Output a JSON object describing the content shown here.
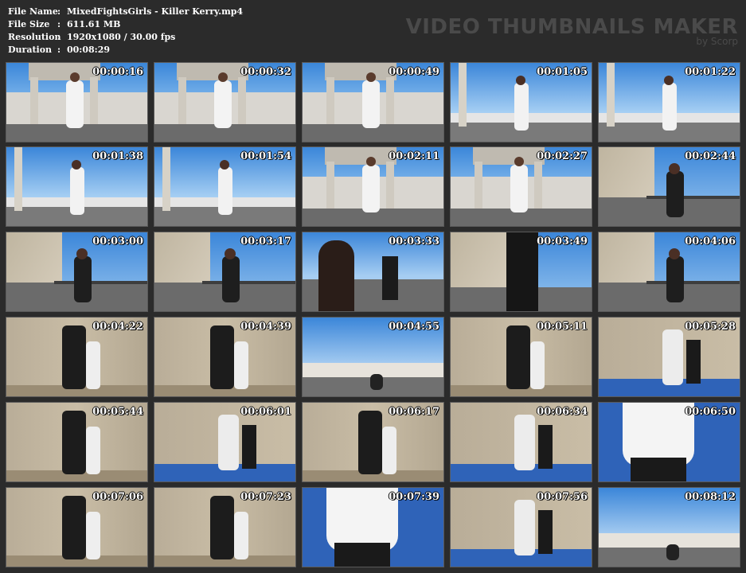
{
  "info": {
    "file_name_label": "File Name",
    "file_name_value": "MixedFightsGirls - Killer Kerry.mp4",
    "file_size_label": "File Size",
    "file_size_value": "611.61 MB",
    "resolution_label": "Resolution",
    "resolution_value": "1920x1080 / 30.00 fps",
    "duration_label": "Duration",
    "duration_value": "00:08:29"
  },
  "brand": {
    "title": "VIDEO THUMBNAILS MAKER",
    "subtitle": "by Scorp"
  },
  "thumbnails": [
    {
      "time": "00:00:16",
      "scene": "sky-building"
    },
    {
      "time": "00:00:32",
      "scene": "sky-building"
    },
    {
      "time": "00:00:49",
      "scene": "sky-building"
    },
    {
      "time": "00:01:05",
      "scene": "sky-harbor"
    },
    {
      "time": "00:01:22",
      "scene": "sky-harbor"
    },
    {
      "time": "00:01:38",
      "scene": "sky-harbor"
    },
    {
      "time": "00:01:54",
      "scene": "sky-harbor"
    },
    {
      "time": "00:02:11",
      "scene": "sky-building"
    },
    {
      "time": "00:02:27",
      "scene": "sky-building"
    },
    {
      "time": "00:02:44",
      "scene": "seawall"
    },
    {
      "time": "00:03:00",
      "scene": "seawall"
    },
    {
      "time": "00:03:17",
      "scene": "seawall"
    },
    {
      "time": "00:03:33",
      "scene": "sky-road"
    },
    {
      "time": "00:03:49",
      "scene": "seawall-close"
    },
    {
      "time": "00:04:06",
      "scene": "seawall"
    },
    {
      "time": "00:04:22",
      "scene": "wall"
    },
    {
      "time": "00:04:39",
      "scene": "wall"
    },
    {
      "time": "00:04:55",
      "scene": "sky-port"
    },
    {
      "time": "00:05:11",
      "scene": "wall"
    },
    {
      "time": "00:05:28",
      "scene": "wall-mat"
    },
    {
      "time": "00:05:44",
      "scene": "wall"
    },
    {
      "time": "00:06:01",
      "scene": "wall-mat"
    },
    {
      "time": "00:06:17",
      "scene": "wall"
    },
    {
      "time": "00:06:34",
      "scene": "wall-mat"
    },
    {
      "time": "00:06:50",
      "scene": "mat-close"
    },
    {
      "time": "00:07:06",
      "scene": "wall"
    },
    {
      "time": "00:07:23",
      "scene": "wall"
    },
    {
      "time": "00:07:39",
      "scene": "mat-close"
    },
    {
      "time": "00:07:56",
      "scene": "wall-mat"
    },
    {
      "time": "00:08:12",
      "scene": "sky-port"
    }
  ],
  "colors": {
    "background": "#2b2b2b",
    "sky": "#3b86d9",
    "concrete": "#c9bda6",
    "asphalt": "#6b6b6b",
    "mat": "#2f63b8"
  }
}
